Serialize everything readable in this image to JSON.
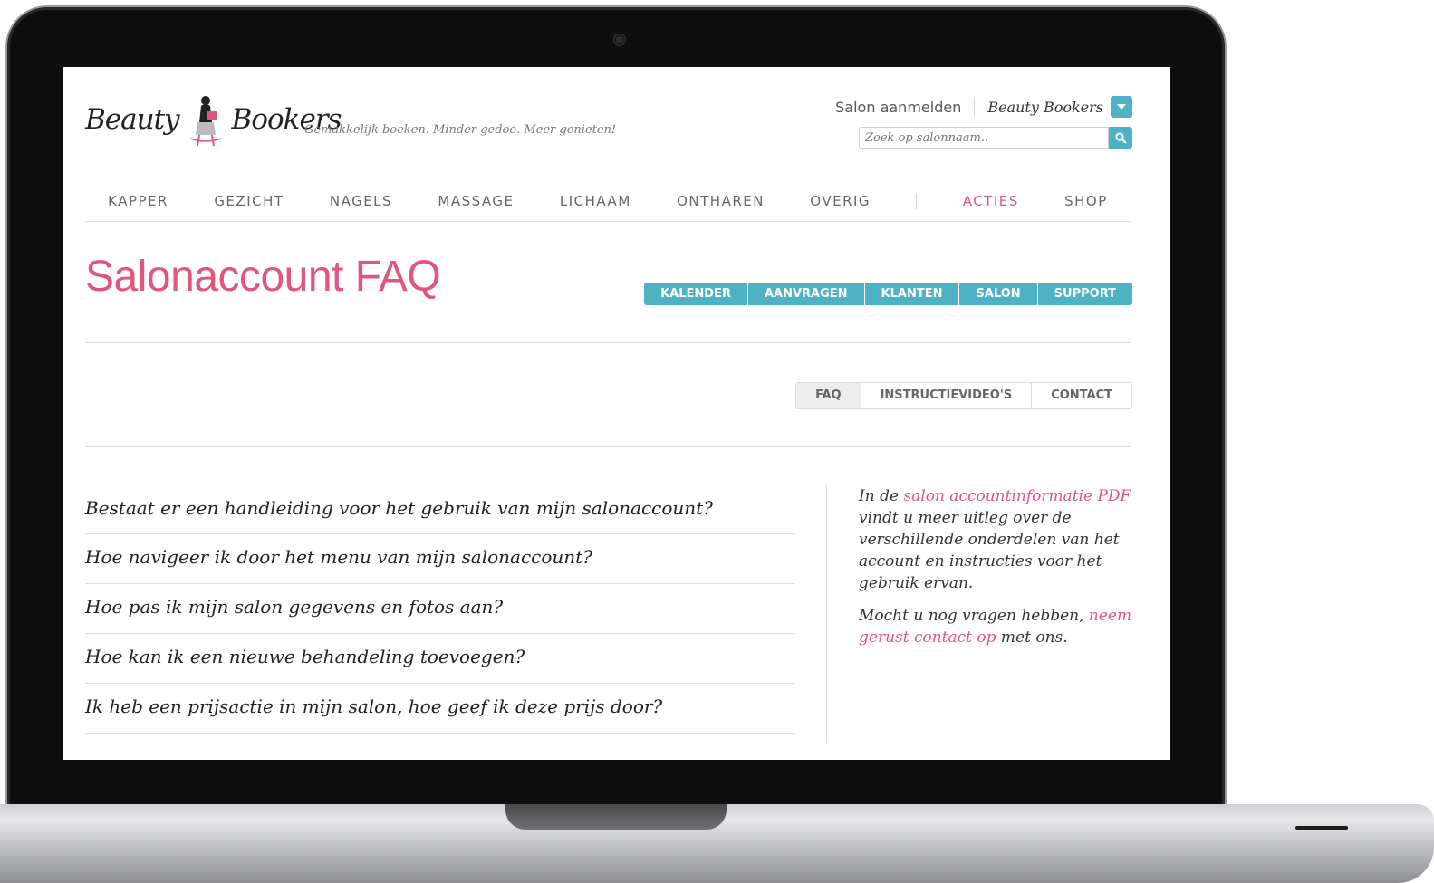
{
  "brand": {
    "logo_left": "Beauty",
    "logo_right": "Bookers",
    "tagline": "Gemakkelijk boeken. Minder gedoe. Meer genieten!"
  },
  "header": {
    "salon_register": "Salon aanmelden",
    "account_name": "Beauty Bookers",
    "dropdown_icon": "chevron-down-icon",
    "search_placeholder": "Zoek op salonnaam..",
    "search_icon": "search-icon"
  },
  "main_nav": {
    "items": [
      "KAPPER",
      "GEZICHT",
      "NAGELS",
      "MASSAGE",
      "LICHAAM",
      "ONTHAREN",
      "OVERIG",
      "ACTIES",
      "SHOP"
    ]
  },
  "page": {
    "title": "Salonaccount FAQ"
  },
  "account_tabs": [
    "KALENDER",
    "AANVRAGEN",
    "KLANTEN",
    "SALON",
    "SUPPORT"
  ],
  "sub_tabs": {
    "items": [
      "FAQ",
      "INSTRUCTIEVIDEO'S",
      "CONTACT"
    ],
    "active": "FAQ"
  },
  "faq": [
    "Bestaat er een handleiding voor het gebruik van mijn salonaccount?",
    "Hoe navigeer ik door het menu van mijn salonaccount?",
    "Hoe pas ik mijn salon gegevens en fotos aan?",
    "Hoe kan ik een nieuwe behandeling toevoegen?",
    "Ik heb een prijsactie in mijn salon, hoe geef ik deze prijs door?"
  ],
  "sidebar": {
    "p1_prefix": "In de ",
    "p1_link": "salon accountinformatie PDF",
    "p1_suffix": " vindt u meer uitleg over de verschillende onderdelen van het account en instructies voor het gebruik ervan.",
    "p2_prefix": "Mocht u nog vragen hebben, ",
    "p2_link": "neem gerust contact op",
    "p2_suffix": " met ons."
  },
  "colors": {
    "accent_pink": "#e0567f",
    "accent_teal": "#4db3c4"
  }
}
